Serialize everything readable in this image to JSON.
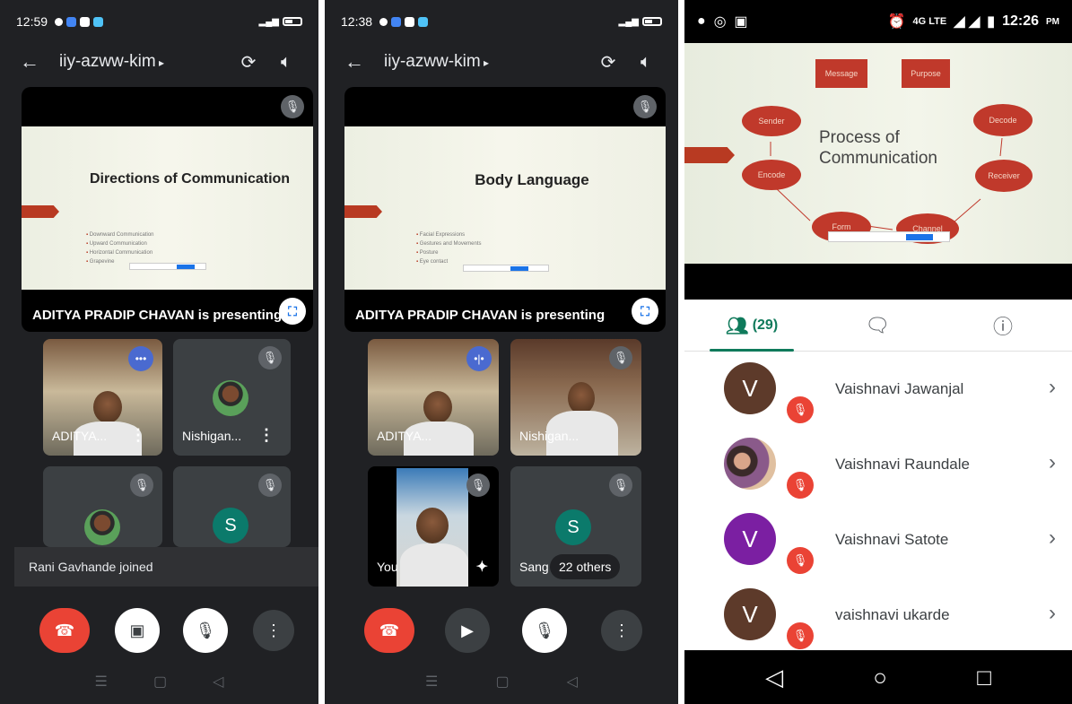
{
  "panel1": {
    "status": {
      "time": "12:59"
    },
    "meeting_code": "iiy-azww-kim",
    "slide": {
      "title": "Directions of Communication",
      "bullets": [
        "Downward Communication",
        "Upward Communication",
        "Horizontal Communication",
        "Grapevine"
      ]
    },
    "presenting_text": "ADITYA PRADIP CHAVAN is presenting",
    "tiles": [
      {
        "name": "ADITYA..."
      },
      {
        "name": "Nishigan..."
      },
      {
        "name": ""
      },
      {
        "initial": "S"
      }
    ],
    "toast": "Rani Gavhande joined"
  },
  "panel2": {
    "status": {
      "time": "12:38"
    },
    "meeting_code": "iiy-azww-kim",
    "slide": {
      "title": "Body Language",
      "bullets": [
        "Facial Expressions",
        "Gestures and Movements",
        "Posture",
        "Eye contact"
      ]
    },
    "presenting_text": "ADITYA PRADIP CHAVAN is presenting",
    "tiles": [
      {
        "name": "ADITYA..."
      },
      {
        "name": "Nishigan..."
      },
      {
        "name": "You"
      },
      {
        "name": "Sang",
        "initial": "S"
      }
    ],
    "others_label": "22 others"
  },
  "panel3": {
    "status": {
      "network": "4G LTE",
      "time": "12:26",
      "ampm": "PM"
    },
    "slide": {
      "title_line1": "Process of",
      "title_line2": "Communication",
      "nodes": [
        "Message",
        "Purpose",
        "Sender",
        "Encode",
        "Form",
        "Channel",
        "Receiver",
        "Decode"
      ]
    },
    "people_count": "(29)",
    "participants": [
      {
        "initial": "V",
        "name": "Vaishnavi Jawanjal",
        "color": "#5d3a2a"
      },
      {
        "initial": "",
        "name": "Vaishnavi Raundale",
        "color": "#b07a6a"
      },
      {
        "initial": "V",
        "name": "Vaishnavi Satote",
        "color": "#7b1fa2"
      },
      {
        "initial": "V",
        "name": "vaishnavi ukarde",
        "color": "#5d3a2a"
      }
    ]
  },
  "colors": {
    "end_call": "#ea4335",
    "accent_green": "#0f7a5b",
    "slide_red": "#c0392b"
  }
}
